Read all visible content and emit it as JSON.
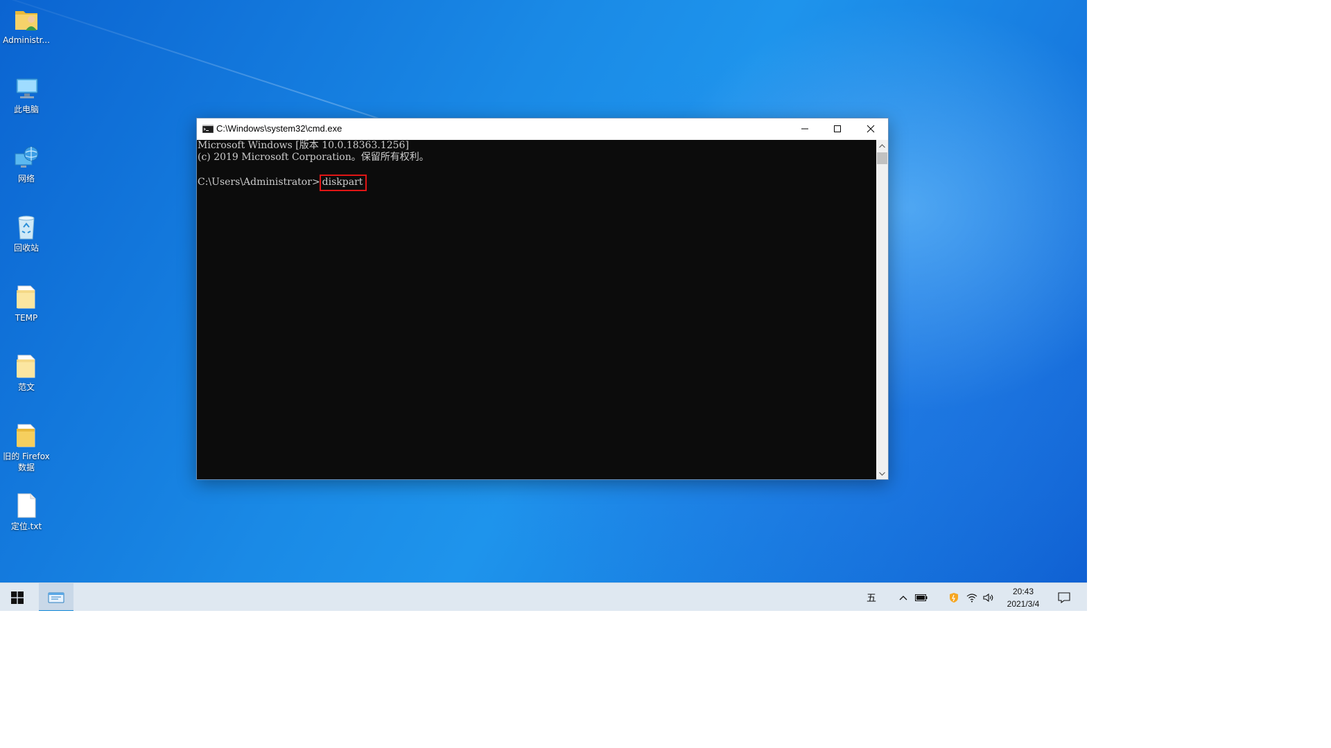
{
  "desktop": {
    "icons": [
      {
        "label": "Administr...",
        "icon": "user-folder-icon"
      },
      {
        "label": "此电脑",
        "icon": "this-pc-icon"
      },
      {
        "label": "网络",
        "icon": "network-icon"
      },
      {
        "label": "回收站",
        "icon": "recycle-bin-icon"
      },
      {
        "label": "TEMP",
        "icon": "folder-icon"
      },
      {
        "label": "范文",
        "icon": "folder-icon"
      },
      {
        "label": "旧的 Firefox 数据",
        "icon": "folder-icon"
      },
      {
        "label": "定位.txt",
        "icon": "text-file-icon"
      }
    ]
  },
  "window": {
    "title": "C:\\Windows\\system32\\cmd.exe",
    "icon": "console-icon",
    "controls": {
      "minimize": "minimize-icon",
      "maximize": "maximize-icon",
      "close": "close-icon"
    },
    "console": {
      "lines": [
        "Microsoft Windows [版本 10.0.18363.1256]",
        "(c) 2019 Microsoft Corporation。保留所有权利。",
        ""
      ],
      "prompt": "C:\\Users\\Administrator>",
      "command": "diskpart",
      "highlight_color": "#e21515"
    }
  },
  "taskbar": {
    "start_icon": "windows-start-icon",
    "pinned": [
      {
        "name": "console-app",
        "icon": "terminal-window-icon",
        "active": true
      }
    ],
    "tray": {
      "ime": "五",
      "chevron": "chevron-up-icon",
      "icons": [
        "battery-icon",
        "security-shield-icon",
        "wifi-icon",
        "volume-icon"
      ],
      "time": "20:43",
      "date": "2021/3/4",
      "notification": "notification-icon"
    }
  },
  "colors": {
    "accent": "#0a84d6",
    "console_bg": "#0c0c0c",
    "console_fg": "#cccccc"
  }
}
